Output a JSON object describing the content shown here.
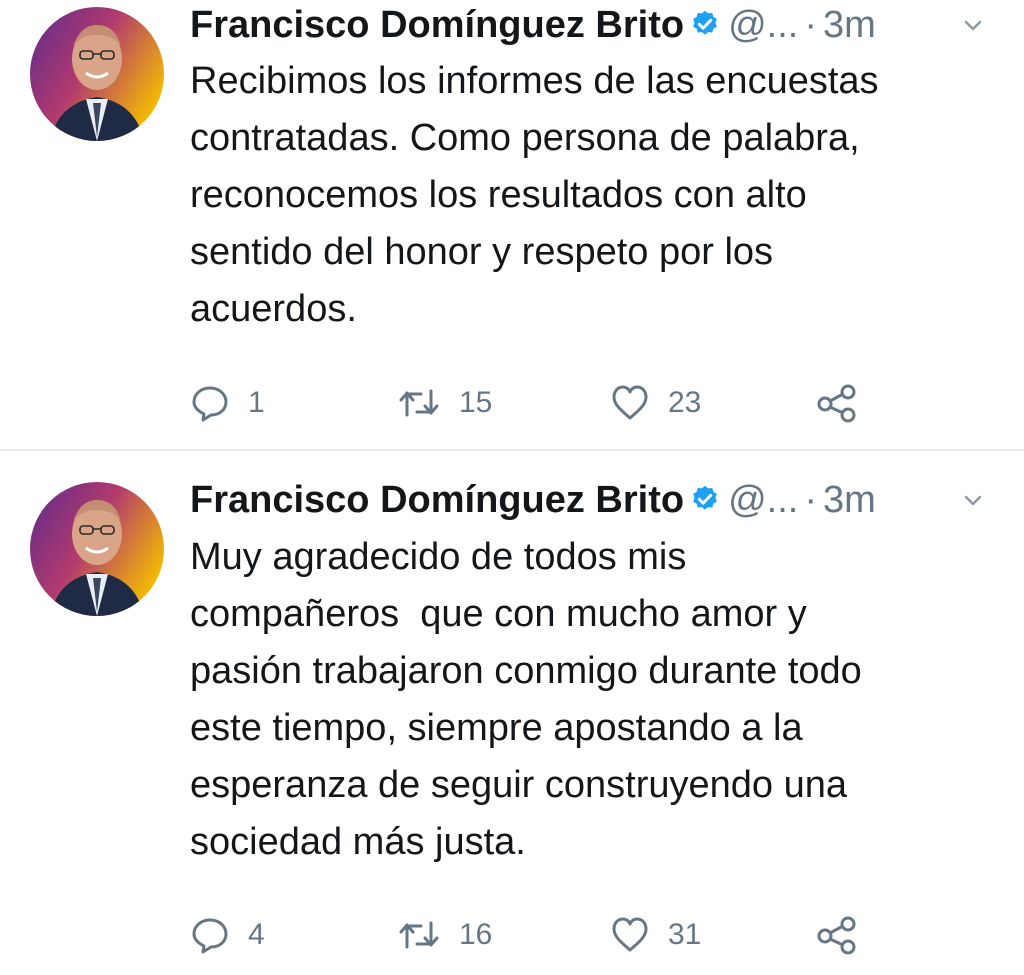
{
  "tweets": [
    {
      "author": "Francisco Domínguez Brito",
      "handle": "@...",
      "separator": "·",
      "time": "3m",
      "text": "Recibimos los informes de las encuestas\ncontratadas. Como persona de palabra,\nreconocemos los resultados con alto\nsentido del honor y respeto por los\nacuerdos.",
      "replies": "1",
      "retweets": "15",
      "likes": "23"
    },
    {
      "author": "Francisco Domínguez Brito",
      "handle": "@...",
      "separator": "·",
      "time": "3m",
      "text": "Muy agradecido de todos mis\ncompañeros  que con mucho amor y\npasión trabajaron conmigo durante todo\neste tiempo, siempre apostando a la\nesperanza de seguir construyendo una\nsociedad más justa.",
      "replies": "4",
      "retweets": "16",
      "likes": "31"
    }
  ],
  "icons": {
    "verified": "verified-badge-icon",
    "caret": "chevron-down-icon",
    "reply": "reply-icon",
    "retweet": "retweet-icon",
    "like": "heart-icon",
    "share": "share-icon"
  },
  "colors": {
    "text_primary": "#14171a",
    "text_secondary": "#657786",
    "verified_blue": "#1da1f2",
    "divider": "#e6ecf0"
  }
}
